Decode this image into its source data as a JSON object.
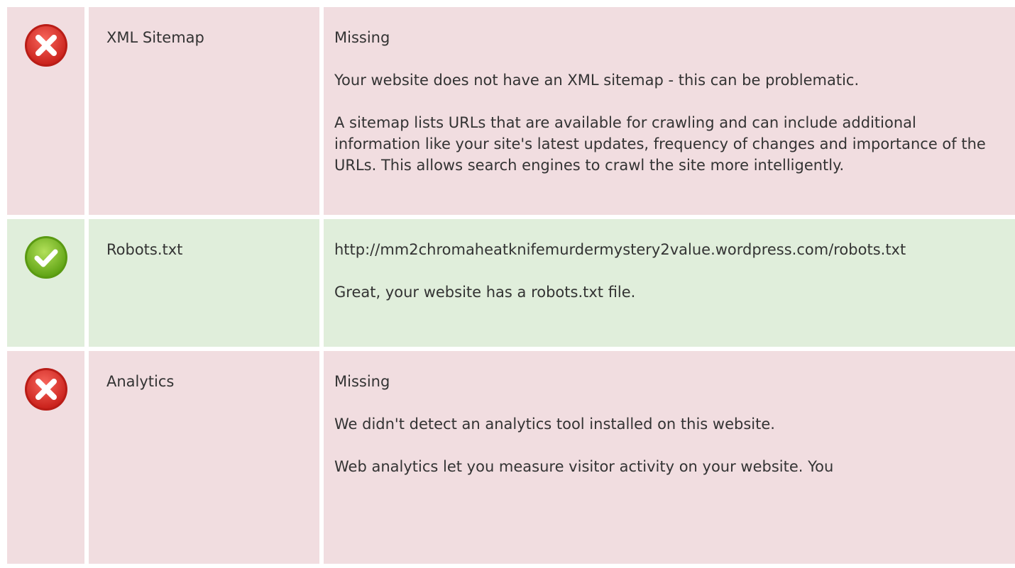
{
  "checks": [
    {
      "status": "fail",
      "icon": "error-x-icon",
      "name": "XML Sitemap",
      "value": "Missing",
      "message": "Your website does not have an XML sitemap - this can be problematic.",
      "description": "A sitemap lists URLs that are available for crawling and can include additional information like your site's latest updates, frequency of changes and importance of the URLs. This allows search engines to crawl the site more intelligently."
    },
    {
      "status": "pass",
      "icon": "success-check-icon",
      "name": "Robots.txt",
      "value": "http://mm2chromaheatknifemurdermystery2value.wordpress.com/robots.txt",
      "message": "Great, your website has a robots.txt file."
    },
    {
      "status": "fail",
      "icon": "error-x-icon",
      "name": "Analytics",
      "value": "Missing",
      "message": "We didn't detect an analytics tool installed on this website.",
      "description": "Web analytics let you measure visitor activity on your website. You"
    }
  ],
  "colors": {
    "fail_bg": "#f1dde0",
    "pass_bg": "#e0eedb",
    "fail_icon": "#e0342c",
    "pass_icon": "#7cbd1e"
  }
}
